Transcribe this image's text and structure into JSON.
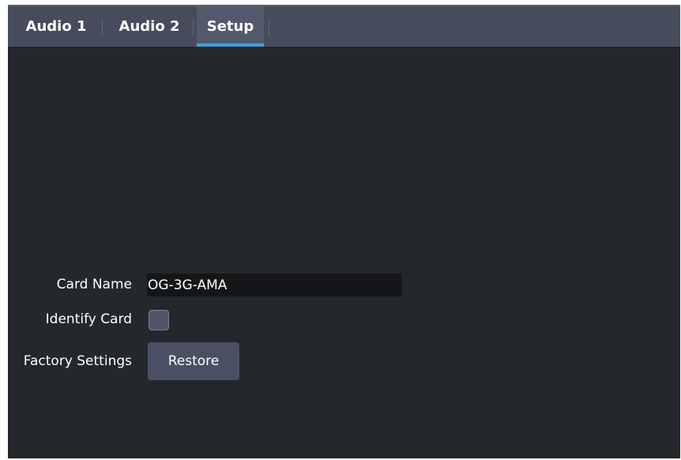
{
  "tabs": [
    {
      "label": "Audio 1",
      "active": false
    },
    {
      "label": "Audio 2",
      "active": false
    },
    {
      "label": "Setup",
      "active": true
    }
  ],
  "setup": {
    "card_name": {
      "label": "Card Name",
      "value": "OG-3G-AMA"
    },
    "identify_card": {
      "label": "Identify Card",
      "checked": false
    },
    "factory_settings": {
      "label": "Factory Settings",
      "button_label": "Restore"
    }
  },
  "colors": {
    "background": "#24272b",
    "tab_bar": "#464c5c",
    "active_tab_underline": "#3f9fe0",
    "input_background": "#141618",
    "button_background": "#4a5063"
  }
}
